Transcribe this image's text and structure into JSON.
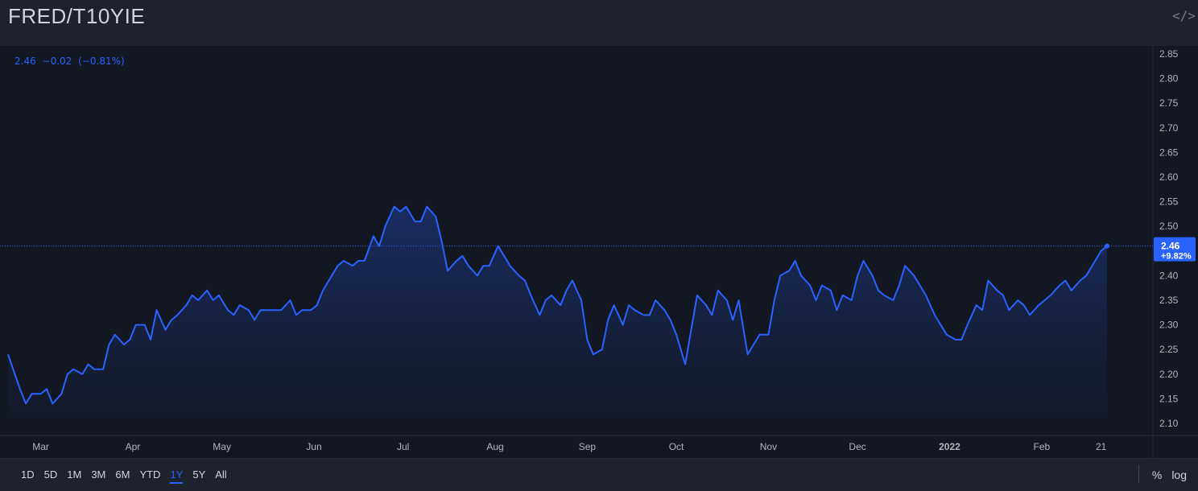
{
  "header": {
    "title": "FRED/T10YIE",
    "embed_icon": "code-embed-icon"
  },
  "legend": {
    "value": "2.46",
    "change": "−0.02",
    "change_pct": "(−0.81%)"
  },
  "last_price": {
    "value": "2.46",
    "change_pct": "+9.82%"
  },
  "footer": {
    "ranges": [
      "1D",
      "5D",
      "1M",
      "3M",
      "6M",
      "YTD",
      "1Y",
      "5Y",
      "All"
    ],
    "active_range": "1Y",
    "percent_label": "%",
    "log_label": "log"
  },
  "colors": {
    "background": "#131722",
    "panel": "#1e222d",
    "line": "#2962ff",
    "text": "#d1d4dc",
    "axis_text": "#b2b5be"
  },
  "chart_data": {
    "type": "area",
    "title": "",
    "xlabel": "",
    "ylabel": "",
    "ylim": [
      2.07,
      2.88
    ],
    "y_ticks": [
      "2.10",
      "2.15",
      "2.20",
      "2.25",
      "2.30",
      "2.35",
      "2.40",
      "2.45",
      "2.50",
      "2.55",
      "2.60",
      "2.65",
      "2.70",
      "2.75",
      "2.80",
      "2.85"
    ],
    "x_ticks": [
      {
        "label": "Mar",
        "date": "2021-03-01"
      },
      {
        "label": "Apr",
        "date": "2021-04-01"
      },
      {
        "label": "May",
        "date": "2021-05-01"
      },
      {
        "label": "Jun",
        "date": "2021-06-01"
      },
      {
        "label": "Jul",
        "date": "2021-07-01"
      },
      {
        "label": "Aug",
        "date": "2021-08-01"
      },
      {
        "label": "Sep",
        "date": "2021-09-01"
      },
      {
        "label": "Oct",
        "date": "2021-10-01"
      },
      {
        "label": "Nov",
        "date": "2021-11-01"
      },
      {
        "label": "Dec",
        "date": "2021-12-01"
      },
      {
        "label": "2022",
        "date": "2022-01-01"
      },
      {
        "label": "Feb",
        "date": "2022-02-01"
      },
      {
        "label": "21",
        "date": "2022-02-21"
      }
    ],
    "xlim": [
      "2021-02-18",
      "2022-02-23"
    ],
    "grid": false,
    "last_value_line": 2.46,
    "series": [
      {
        "points": [
          [
            "2021-02-18",
            2.24
          ],
          [
            "2021-02-22",
            2.17
          ],
          [
            "2021-02-24",
            2.14
          ],
          [
            "2021-02-26",
            2.16
          ],
          [
            "2021-03-01",
            2.16
          ],
          [
            "2021-03-03",
            2.17
          ],
          [
            "2021-03-05",
            2.14
          ],
          [
            "2021-03-08",
            2.16
          ],
          [
            "2021-03-10",
            2.2
          ],
          [
            "2021-03-12",
            2.21
          ],
          [
            "2021-03-15",
            2.2
          ],
          [
            "2021-03-17",
            2.22
          ],
          [
            "2021-03-19",
            2.21
          ],
          [
            "2021-03-22",
            2.21
          ],
          [
            "2021-03-24",
            2.26
          ],
          [
            "2021-03-26",
            2.28
          ],
          [
            "2021-03-29",
            2.26
          ],
          [
            "2021-03-31",
            2.27
          ],
          [
            "2021-04-02",
            2.3
          ],
          [
            "2021-04-05",
            2.3
          ],
          [
            "2021-04-07",
            2.27
          ],
          [
            "2021-04-09",
            2.33
          ],
          [
            "2021-04-12",
            2.29
          ],
          [
            "2021-04-14",
            2.31
          ],
          [
            "2021-04-16",
            2.32
          ],
          [
            "2021-04-19",
            2.34
          ],
          [
            "2021-04-21",
            2.36
          ],
          [
            "2021-04-23",
            2.35
          ],
          [
            "2021-04-26",
            2.37
          ],
          [
            "2021-04-28",
            2.35
          ],
          [
            "2021-04-30",
            2.36
          ],
          [
            "2021-05-03",
            2.33
          ],
          [
            "2021-05-05",
            2.32
          ],
          [
            "2021-05-07",
            2.34
          ],
          [
            "2021-05-10",
            2.33
          ],
          [
            "2021-05-12",
            2.31
          ],
          [
            "2021-05-14",
            2.33
          ],
          [
            "2021-05-17",
            2.33
          ],
          [
            "2021-05-19",
            2.33
          ],
          [
            "2021-05-21",
            2.33
          ],
          [
            "2021-05-24",
            2.35
          ],
          [
            "2021-05-26",
            2.32
          ],
          [
            "2021-05-28",
            2.33
          ],
          [
            "2021-05-31",
            2.33
          ],
          [
            "2021-06-02",
            2.34
          ],
          [
            "2021-06-04",
            2.37
          ],
          [
            "2021-06-07",
            2.4
          ],
          [
            "2021-06-09",
            2.42
          ],
          [
            "2021-06-11",
            2.43
          ],
          [
            "2021-06-14",
            2.42
          ],
          [
            "2021-06-16",
            2.43
          ],
          [
            "2021-06-18",
            2.43
          ],
          [
            "2021-06-21",
            2.48
          ],
          [
            "2021-06-23",
            2.46
          ],
          [
            "2021-06-25",
            2.5
          ],
          [
            "2021-06-28",
            2.54
          ],
          [
            "2021-06-30",
            2.53
          ],
          [
            "2021-07-02",
            2.54
          ],
          [
            "2021-07-05",
            2.51
          ],
          [
            "2021-07-07",
            2.51
          ],
          [
            "2021-07-09",
            2.54
          ],
          [
            "2021-07-12",
            2.52
          ],
          [
            "2021-07-14",
            2.47
          ],
          [
            "2021-07-16",
            2.41
          ],
          [
            "2021-07-19",
            2.43
          ],
          [
            "2021-07-21",
            2.44
          ],
          [
            "2021-07-23",
            2.42
          ],
          [
            "2021-07-26",
            2.4
          ],
          [
            "2021-07-28",
            2.42
          ],
          [
            "2021-07-30",
            2.42
          ],
          [
            "2021-08-02",
            2.46
          ],
          [
            "2021-08-04",
            2.44
          ],
          [
            "2021-08-06",
            2.42
          ],
          [
            "2021-08-09",
            2.4
          ],
          [
            "2021-08-11",
            2.39
          ],
          [
            "2021-08-13",
            2.36
          ],
          [
            "2021-08-16",
            2.32
          ],
          [
            "2021-08-18",
            2.35
          ],
          [
            "2021-08-20",
            2.36
          ],
          [
            "2021-08-23",
            2.34
          ],
          [
            "2021-08-25",
            2.37
          ],
          [
            "2021-08-27",
            2.39
          ],
          [
            "2021-08-30",
            2.35
          ],
          [
            "2021-09-01",
            2.27
          ],
          [
            "2021-09-03",
            2.24
          ],
          [
            "2021-09-06",
            2.25
          ],
          [
            "2021-09-08",
            2.31
          ],
          [
            "2021-09-10",
            2.34
          ],
          [
            "2021-09-13",
            2.3
          ],
          [
            "2021-09-15",
            2.34
          ],
          [
            "2021-09-17",
            2.33
          ],
          [
            "2021-09-20",
            2.32
          ],
          [
            "2021-09-22",
            2.32
          ],
          [
            "2021-09-24",
            2.35
          ],
          [
            "2021-09-27",
            2.33
          ],
          [
            "2021-09-29",
            2.31
          ],
          [
            "2021-10-01",
            2.28
          ],
          [
            "2021-10-04",
            2.22
          ],
          [
            "2021-10-06",
            2.29
          ],
          [
            "2021-10-08",
            2.36
          ],
          [
            "2021-10-11",
            2.34
          ],
          [
            "2021-10-13",
            2.32
          ],
          [
            "2021-10-15",
            2.37
          ],
          [
            "2021-10-18",
            2.35
          ],
          [
            "2021-10-20",
            2.31
          ],
          [
            "2021-10-22",
            2.35
          ],
          [
            "2021-10-25",
            2.24
          ],
          [
            "2021-10-27",
            2.26
          ],
          [
            "2021-10-29",
            2.28
          ],
          [
            "2021-11-01",
            2.28
          ],
          [
            "2021-11-03",
            2.35
          ],
          [
            "2021-11-05",
            2.4
          ],
          [
            "2021-11-08",
            2.41
          ],
          [
            "2021-11-10",
            2.43
          ],
          [
            "2021-11-12",
            2.4
          ],
          [
            "2021-11-15",
            2.38
          ],
          [
            "2021-11-17",
            2.35
          ],
          [
            "2021-11-19",
            2.38
          ],
          [
            "2021-11-22",
            2.37
          ],
          [
            "2021-11-24",
            2.33
          ],
          [
            "2021-11-26",
            2.36
          ],
          [
            "2021-11-29",
            2.35
          ],
          [
            "2021-12-01",
            2.4
          ],
          [
            "2021-12-03",
            2.43
          ],
          [
            "2021-12-06",
            2.4
          ],
          [
            "2021-12-08",
            2.37
          ],
          [
            "2021-12-10",
            2.36
          ],
          [
            "2021-12-13",
            2.35
          ],
          [
            "2021-12-15",
            2.38
          ],
          [
            "2021-12-17",
            2.42
          ],
          [
            "2021-12-20",
            2.4
          ],
          [
            "2021-12-22",
            2.38
          ],
          [
            "2021-12-24",
            2.36
          ],
          [
            "2021-12-27",
            2.32
          ],
          [
            "2021-12-29",
            2.3
          ],
          [
            "2021-12-31",
            2.28
          ],
          [
            "2022-01-03",
            2.27
          ],
          [
            "2022-01-05",
            2.27
          ],
          [
            "2022-01-07",
            2.3
          ],
          [
            "2022-01-10",
            2.34
          ],
          [
            "2022-01-12",
            2.33
          ],
          [
            "2022-01-14",
            2.39
          ],
          [
            "2022-01-17",
            2.37
          ],
          [
            "2022-01-19",
            2.36
          ],
          [
            "2022-01-21",
            2.33
          ],
          [
            "2022-01-24",
            2.35
          ],
          [
            "2022-01-26",
            2.34
          ],
          [
            "2022-01-28",
            2.32
          ],
          [
            "2022-01-31",
            2.34
          ],
          [
            "2022-02-02",
            2.35
          ],
          [
            "2022-02-04",
            2.36
          ],
          [
            "2022-02-07",
            2.38
          ],
          [
            "2022-02-09",
            2.39
          ],
          [
            "2022-02-11",
            2.37
          ],
          [
            "2022-02-14",
            2.39
          ],
          [
            "2022-02-16",
            2.4
          ],
          [
            "2022-02-18",
            2.42
          ],
          [
            "2022-02-21",
            2.45
          ],
          [
            "2022-02-23",
            2.46
          ]
        ]
      }
    ]
  }
}
